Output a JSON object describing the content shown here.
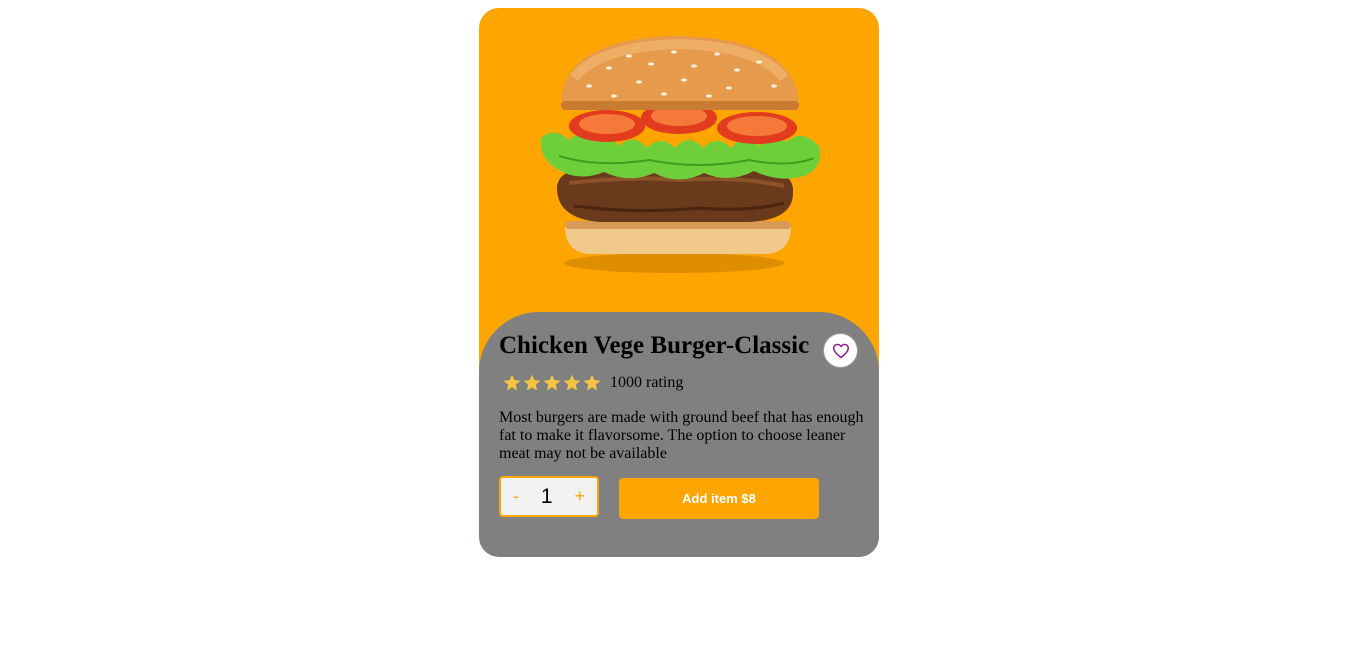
{
  "product": {
    "title": "Chicken Vege Burger-Classic",
    "rating_stars": 5,
    "rating_text": "1000 rating",
    "description": "Most burgers are made with ground beef that has enough fat to make it flavorsome. The option to choose leaner meat may not be available",
    "image_icon": "burger-image"
  },
  "quantity": {
    "minus_label": "-",
    "value": "1",
    "plus_label": "+"
  },
  "add_button": {
    "label": "Add item $8"
  },
  "colors": {
    "accent": "#ffa500",
    "panel": "#808080",
    "star": "#f5c542",
    "heart": "#8b1a8b"
  }
}
